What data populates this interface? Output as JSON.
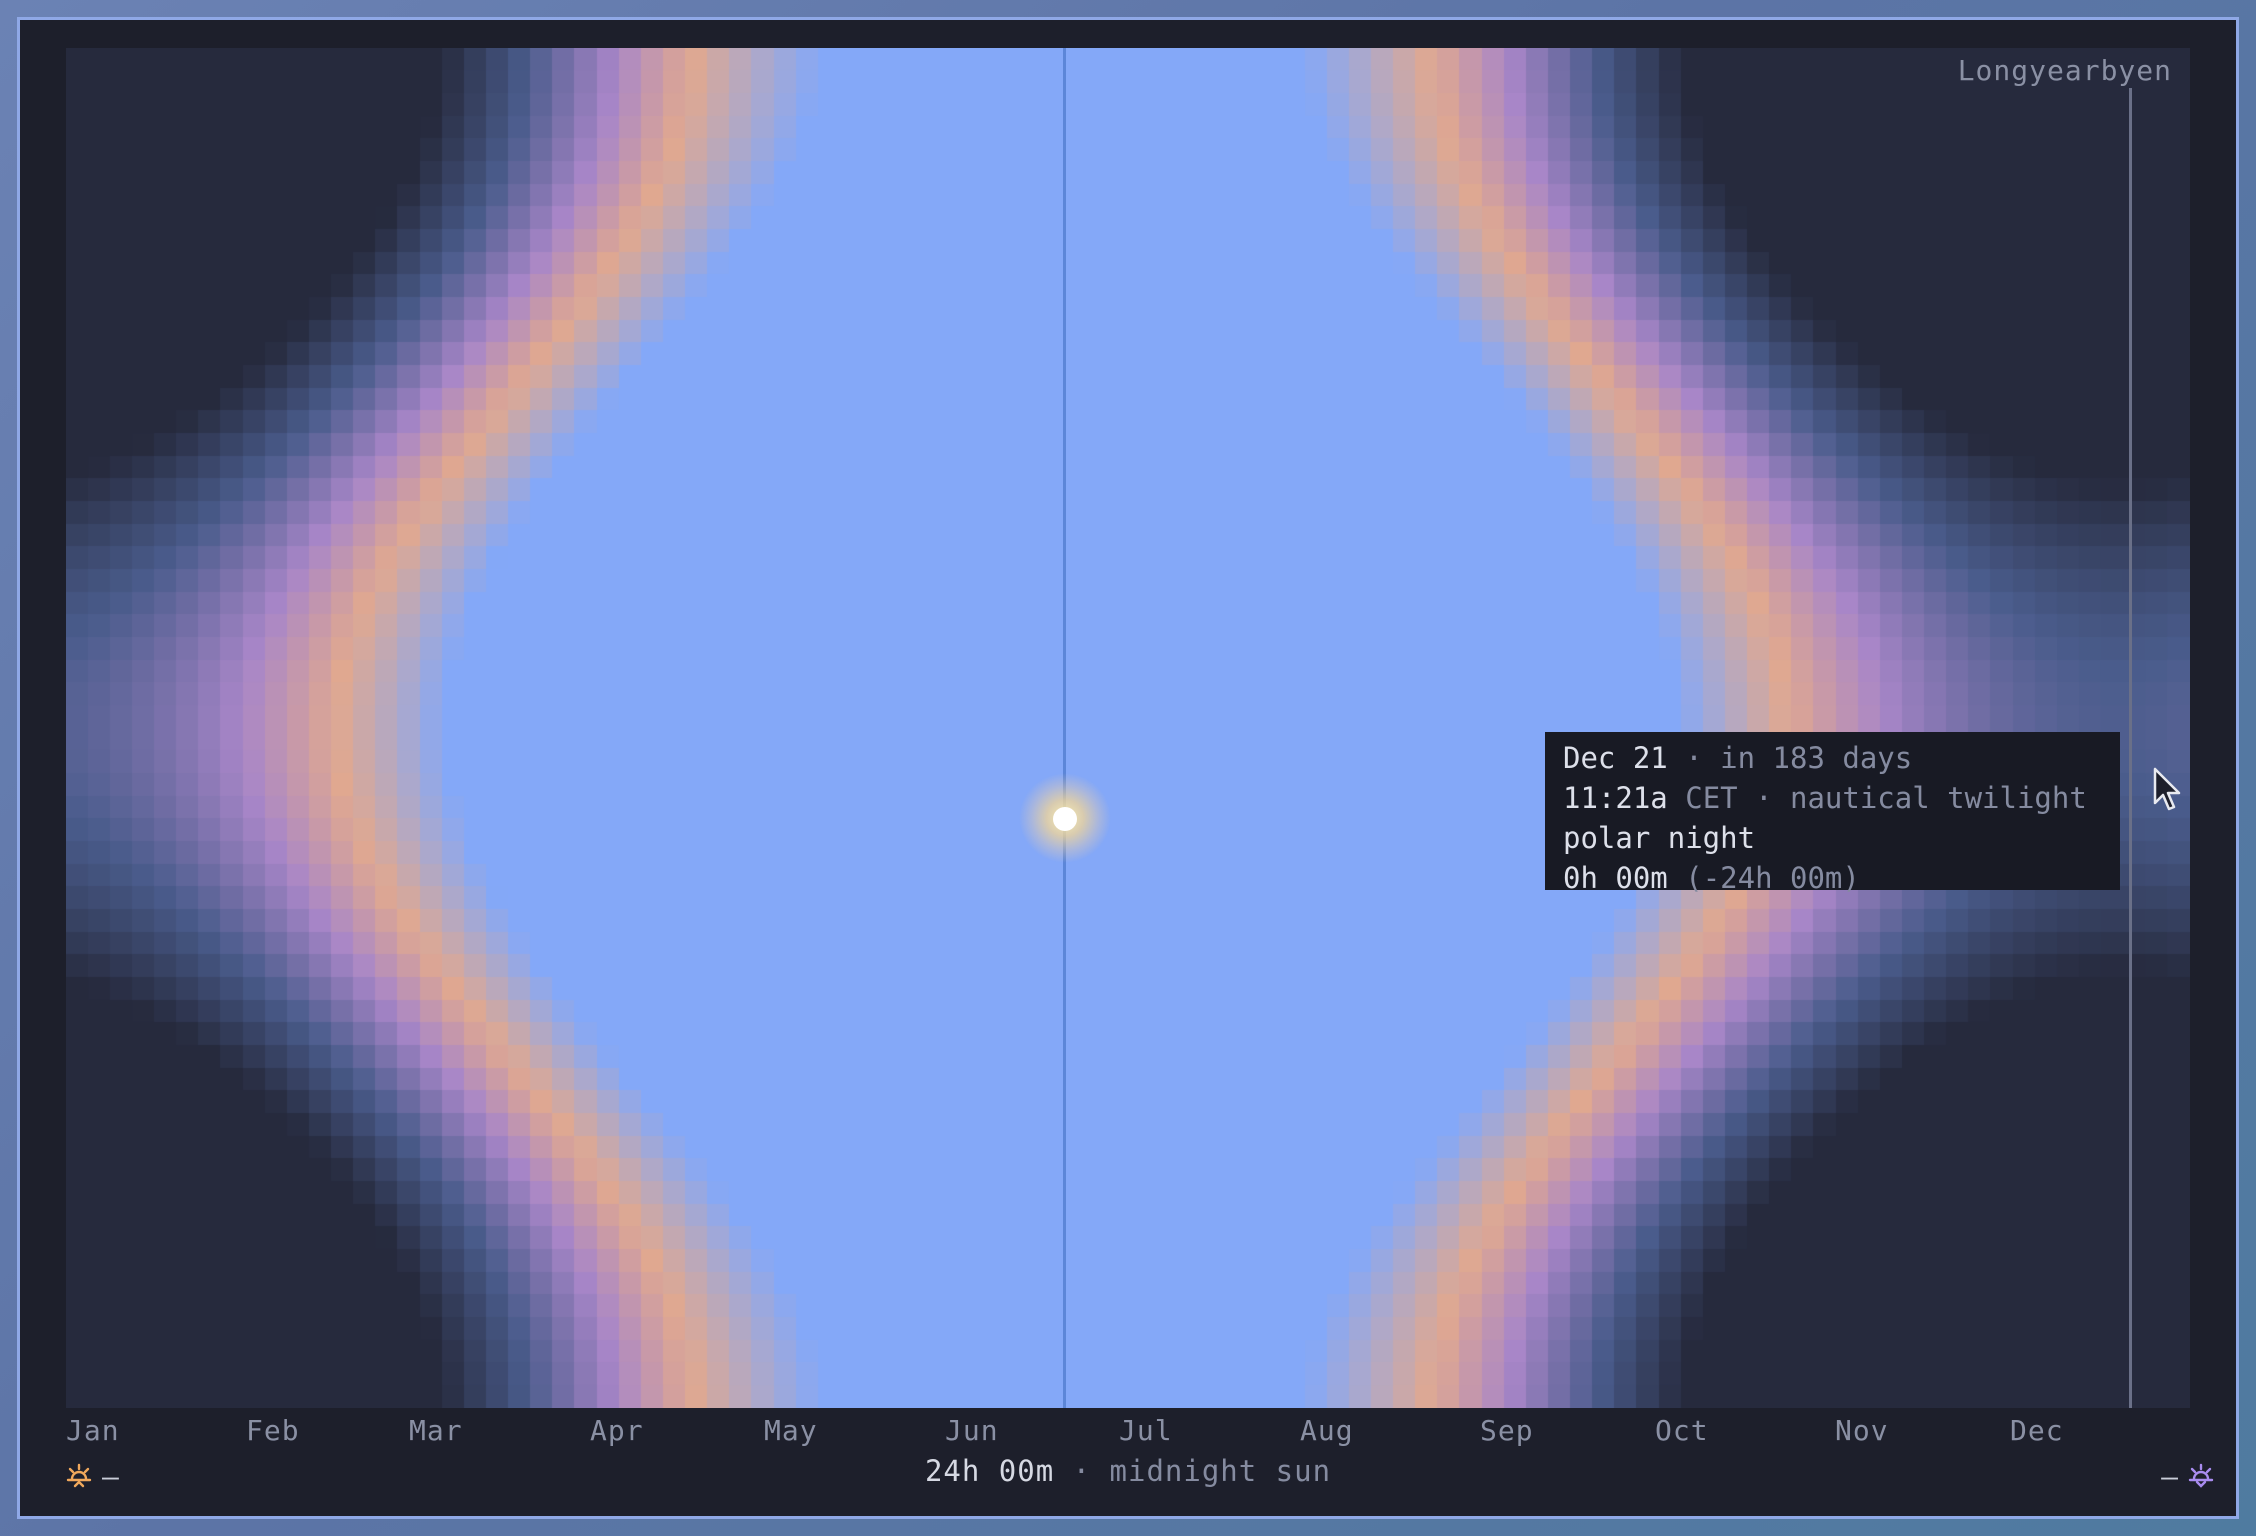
{
  "location": "Longyearbyen",
  "months": [
    "Jan",
    "Feb",
    "Mar",
    "Apr",
    "May",
    "Jun",
    "Jul",
    "Aug",
    "Sep",
    "Oct",
    "Nov",
    "Dec"
  ],
  "tooltip": {
    "date": "Dec 21",
    "relative": "· in 183 days",
    "time": "11:21a",
    "timezone_phase": "CET · nautical twilight",
    "status": "polar night",
    "day_length": "0h 00m",
    "day_length_delta": "(-24h 00m)"
  },
  "footer": {
    "day_length": "24h 00m",
    "day_status": "· midnight sun",
    "left_value": "—",
    "right_value": "—",
    "sunrise_icon": "sunrise-icon",
    "sunset_icon": "sunset-icon"
  },
  "colors": {
    "night": "#262a3d",
    "blue_hour": "#4a5c8c",
    "twilight_purple": "#a886c8",
    "golden_hour": "#e0a890",
    "day": "#84a8f8",
    "accent": "#f0a85c",
    "sunset_accent": "#a98cf0",
    "today_line": "#5c86d8"
  }
}
